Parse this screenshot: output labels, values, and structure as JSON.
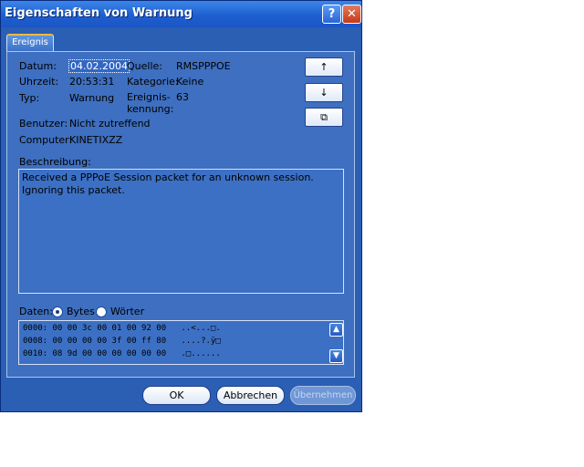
{
  "window": {
    "title": "Eigenschaften von Warnung",
    "help_label": "?",
    "close_label": "✕"
  },
  "tabs": [
    {
      "label": "Ereignis"
    }
  ],
  "fields": {
    "datum_label": "Datum:",
    "datum_value": "04.02.2004",
    "uhrzeit_label": "Uhrzeit:",
    "uhrzeit_value": "20:53:31",
    "typ_label": "Typ:",
    "typ_value": "Warnung",
    "benutzer_label": "Benutzer:",
    "benutzer_value": "Nicht zutreffend",
    "computer_label": "Computer:",
    "computer_value": "KINETIXZZ",
    "quelle_label": "Quelle:",
    "quelle_value": "RMSPPPOE",
    "kategorie_label": "Kategorie:",
    "kategorie_value": "Keine",
    "ereignis_label_1": "Ereignis-",
    "ereignis_label_2": "kennung:",
    "ereignis_value": "63"
  },
  "nav_buttons": {
    "up": "↑",
    "down": "↓",
    "copy": "⧉"
  },
  "description": {
    "label": "Beschreibung:",
    "text": "Received a PPPoE Session packet for an unknown session. Ignoring this packet."
  },
  "data_section": {
    "label": "Daten:",
    "options": [
      {
        "label": "Bytes",
        "selected": true
      },
      {
        "label": "Wörter",
        "selected": false
      }
    ],
    "hex_lines": [
      "0000: 00 00 3c 00 01 00 92 00   ..<...□.",
      "0008: 00 00 00 00 3f 00 ff 80   ....?.ÿ□",
      "0010: 08 9d 00 00 00 00 00 00   .□......"
    ]
  },
  "buttons": {
    "ok": "OK",
    "cancel": "Abbrechen",
    "apply": "Übernehmen"
  },
  "colors": {
    "dialog_bg": "#2b5fb4",
    "panel_bg": "#3e6fc0",
    "titlebar": "#1d5fd0",
    "selection": "#3167c4"
  }
}
